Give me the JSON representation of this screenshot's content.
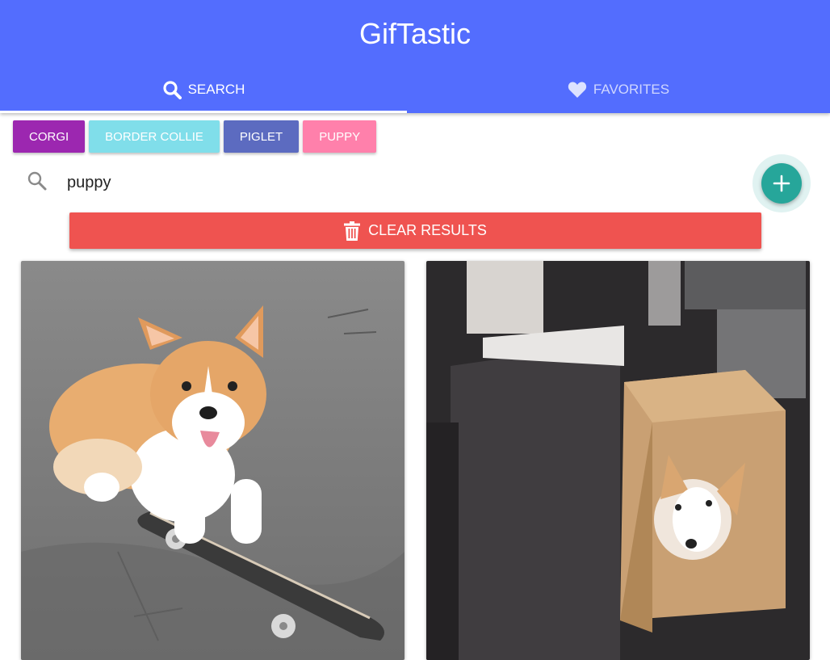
{
  "app": {
    "title": "GifTastic"
  },
  "tabs": [
    {
      "label": "Search",
      "icon": "search-icon",
      "active": true
    },
    {
      "label": "Favorites",
      "icon": "heart-icon",
      "active": false
    }
  ],
  "chips": [
    {
      "label": "Corgi",
      "color": "#9c27b0"
    },
    {
      "label": "Border Collie",
      "color": "#80deea"
    },
    {
      "label": "Piglet",
      "color": "#5c6bc0"
    },
    {
      "label": "Puppy",
      "color": "#ff80ab"
    }
  ],
  "search": {
    "value": "puppy",
    "icon": "search-icon"
  },
  "add_button": {
    "icon": "plus-icon",
    "color": "#26a69a"
  },
  "clear_button": {
    "label": "Clear Results",
    "icon": "trash-icon",
    "color": "#ef5350"
  },
  "results": [
    {
      "subject": "corgi-on-skateboard-gif"
    },
    {
      "subject": "corgi-in-cardboard-box-gif"
    }
  ],
  "colors": {
    "header": "#536dfe"
  }
}
